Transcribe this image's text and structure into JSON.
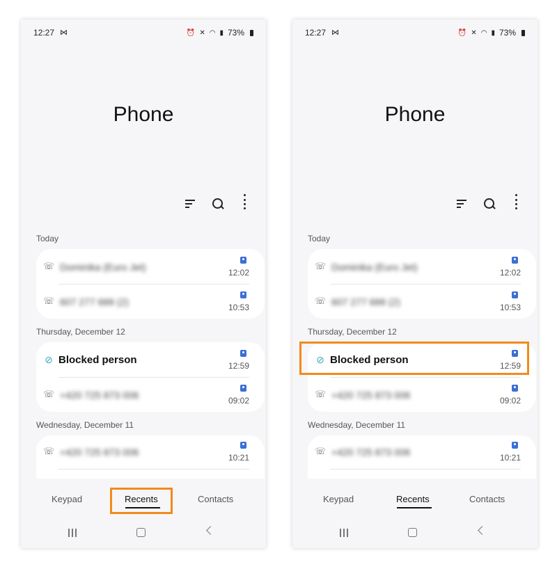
{
  "screens": [
    {
      "status_bar": {
        "time": "12:27",
        "mail_glyph": "⋈",
        "battery": "73%"
      },
      "title": "Phone",
      "sections": [
        {
          "label": "Today",
          "rows": [
            {
              "name": "Dominika (Euro Jet)",
              "time": "12:02",
              "icon": "missed-call-icon"
            },
            {
              "name": "607 277 688 (2)",
              "time": "10:53",
              "icon": "outgoing-call-icon"
            }
          ]
        },
        {
          "label": "Thursday, December 12",
          "rows": [
            {
              "name": "Blocked person",
              "time": "12:59",
              "icon": "blocked-icon"
            },
            {
              "name": "+420 725 873 006",
              "time": "09:02",
              "icon": "missed-call-icon"
            }
          ]
        },
        {
          "label": "Wednesday, December 11",
          "rows": [
            {
              "name": "+420 725 873 006",
              "time": "10:21",
              "icon": "missed-call-icon"
            }
          ]
        }
      ],
      "tabs": [
        "Keypad",
        "Recents",
        "Contacts"
      ],
      "active_tab": "Recents"
    },
    {
      "status_bar": {
        "time": "12:27",
        "mail_glyph": "⋈",
        "battery": "73%"
      },
      "title": "Phone",
      "sections": [
        {
          "label": "Today",
          "rows": [
            {
              "name": "Dominika (Euro Jet)",
              "time": "12:02",
              "icon": "missed-call-icon"
            },
            {
              "name": "607 277 688 (2)",
              "time": "10:53",
              "icon": "outgoing-call-icon"
            }
          ]
        },
        {
          "label": "Thursday, December 12",
          "rows": [
            {
              "name": "Blocked person",
              "time": "12:59",
              "icon": "blocked-icon"
            },
            {
              "name": "+420 725 873 006",
              "time": "09:02",
              "icon": "missed-call-icon"
            }
          ]
        },
        {
          "label": "Wednesday, December 11",
          "rows": [
            {
              "name": "+420 725 873 006",
              "time": "10:21",
              "icon": "missed-call-icon"
            }
          ]
        }
      ],
      "tabs": [
        "Keypad",
        "Recents",
        "Contacts"
      ],
      "active_tab": "Recents"
    }
  ],
  "colors": {
    "highlight": "#f28a1b",
    "badge": "#3b6fd6",
    "notification_dot": "#e2541d",
    "blocked_icon": "#3aa6b9"
  }
}
